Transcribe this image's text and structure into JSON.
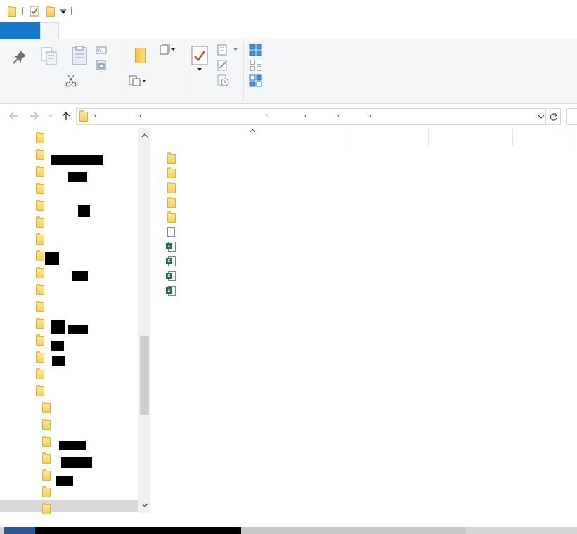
{
  "window": {
    "title": ""
  },
  "quick_access_toolbar": {
    "items": [
      "folder-icon",
      "properties-check-icon",
      "new-folder-icon",
      "customize-dropdown-icon"
    ]
  },
  "ribbon": {
    "tabs": [
      {
        "label": "",
        "active": false,
        "color": "#1979ca"
      },
      {
        "label": "",
        "active": true
      }
    ],
    "clipboard_group": [
      "pin-icon",
      "copy-icon",
      "paste-icon",
      "copy-path-icon",
      "paste-shortcut-icon",
      "cut-icon"
    ],
    "organize_group": [
      "move-to-icon",
      "new-item-icon",
      "copy-to-icon"
    ],
    "open_group": [
      "properties-icon",
      "open-icon",
      "edit-icon",
      "history-icon"
    ],
    "select_group": [
      "select-all-icon",
      "select-none-icon",
      "invert-selection-icon"
    ]
  },
  "address_bar": {
    "back_icon": "back-arrow-icon",
    "forward_icon": "forward-arrow-icon",
    "recent_icon": "recent-dropdown-icon",
    "up_icon": "up-arrow-icon",
    "separators": 6,
    "refresh_icon": "refresh-icon"
  },
  "nav_pane": {
    "items": [
      {
        "icon": "folder-icon",
        "label": ""
      },
      {
        "icon": "folder-icon",
        "label": "",
        "redacted": true
      },
      {
        "icon": "folder-icon",
        "label": "",
        "redacted": true
      },
      {
        "icon": "folder-icon",
        "label": ""
      },
      {
        "icon": "folder-icon",
        "label": "",
        "redacted": true
      },
      {
        "icon": "folder-icon",
        "label": ""
      },
      {
        "icon": "folder-icon",
        "label": ""
      },
      {
        "icon": "folder-icon",
        "label": "",
        "redacted": true
      },
      {
        "icon": "folder-icon",
        "label": "",
        "redacted": true
      },
      {
        "icon": "folder-icon",
        "label": ""
      },
      {
        "icon": "folder-icon",
        "label": ""
      },
      {
        "icon": "folder-icon",
        "label": "",
        "redacted": true
      },
      {
        "icon": "folder-icon",
        "label": "",
        "redacted": true
      },
      {
        "icon": "folder-icon",
        "label": "",
        "redacted": true
      },
      {
        "icon": "folder-icon",
        "label": ""
      },
      {
        "icon": "folder-icon",
        "label": ""
      },
      {
        "icon": "folder-icon",
        "label": ""
      },
      {
        "icon": "folder-icon",
        "label": ""
      },
      {
        "icon": "folder-icon",
        "label": "",
        "redacted": true
      },
      {
        "icon": "folder-icon",
        "label": "",
        "redacted": true
      },
      {
        "icon": "folder-icon",
        "label": "",
        "redacted": true
      },
      {
        "icon": "folder-icon",
        "label": ""
      },
      {
        "icon": "folder-icon",
        "label": "",
        "selected": true
      }
    ]
  },
  "file_list": {
    "columns": [
      "",
      "",
      "",
      ""
    ],
    "sort_indicator": "sort-ascending-icon",
    "rows": [
      {
        "type": "folder",
        "icon": "folder-icon",
        "name": ""
      },
      {
        "type": "folder",
        "icon": "folder-icon",
        "name": ""
      },
      {
        "type": "folder",
        "icon": "folder-icon",
        "name": ""
      },
      {
        "type": "folder",
        "icon": "folder-icon",
        "name": ""
      },
      {
        "type": "folder",
        "icon": "folder-icon",
        "name": ""
      },
      {
        "type": "file",
        "icon": "blank-file-icon",
        "name": ""
      },
      {
        "type": "excel",
        "icon": "excel-file-icon",
        "name": ""
      },
      {
        "type": "excel",
        "icon": "excel-file-icon",
        "name": ""
      },
      {
        "type": "excel",
        "icon": "excel-file-icon",
        "name": ""
      },
      {
        "type": "excel",
        "icon": "excel-file-icon",
        "name": ""
      }
    ]
  },
  "colors": {
    "file_tab": "#1979ca",
    "ribbon_bg": "#f5f6f7",
    "folder": "#f6cf5a",
    "excel": "#1e7145",
    "selection": "#d9d9d9"
  }
}
